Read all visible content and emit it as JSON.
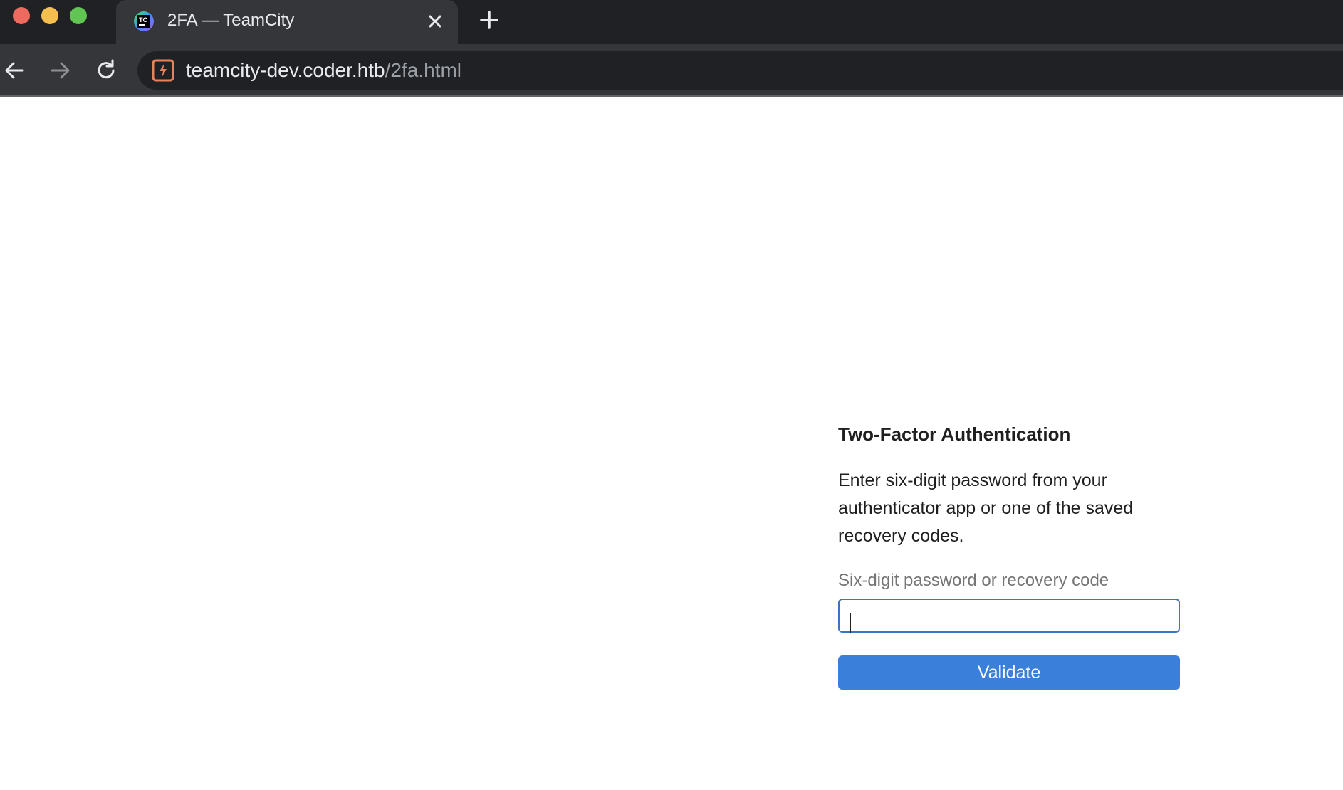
{
  "browser": {
    "tab": {
      "title": "2FA — TeamCity",
      "favicon": "teamcity-logo-icon"
    },
    "address_bar": {
      "host": "teamcity-dev.coder.htb",
      "path": "/2fa.html",
      "site_icon": "not-secure-icon"
    },
    "icons": {
      "close_tab": "close-icon",
      "new_tab": "plus-icon",
      "back": "arrow-left-icon",
      "forward": "arrow-right-icon",
      "reload": "reload-icon"
    }
  },
  "twofa": {
    "title": "Two-Factor Authentication",
    "description": "Enter six-digit password from your authenticator app or one of the saved recovery codes.",
    "field_label": "Six-digit password or recovery code",
    "input_value": "",
    "button_label": "Validate"
  },
  "colors": {
    "accent": "#3a80da",
    "input_border": "#3a75c4",
    "site_icon": "#e8825a"
  }
}
